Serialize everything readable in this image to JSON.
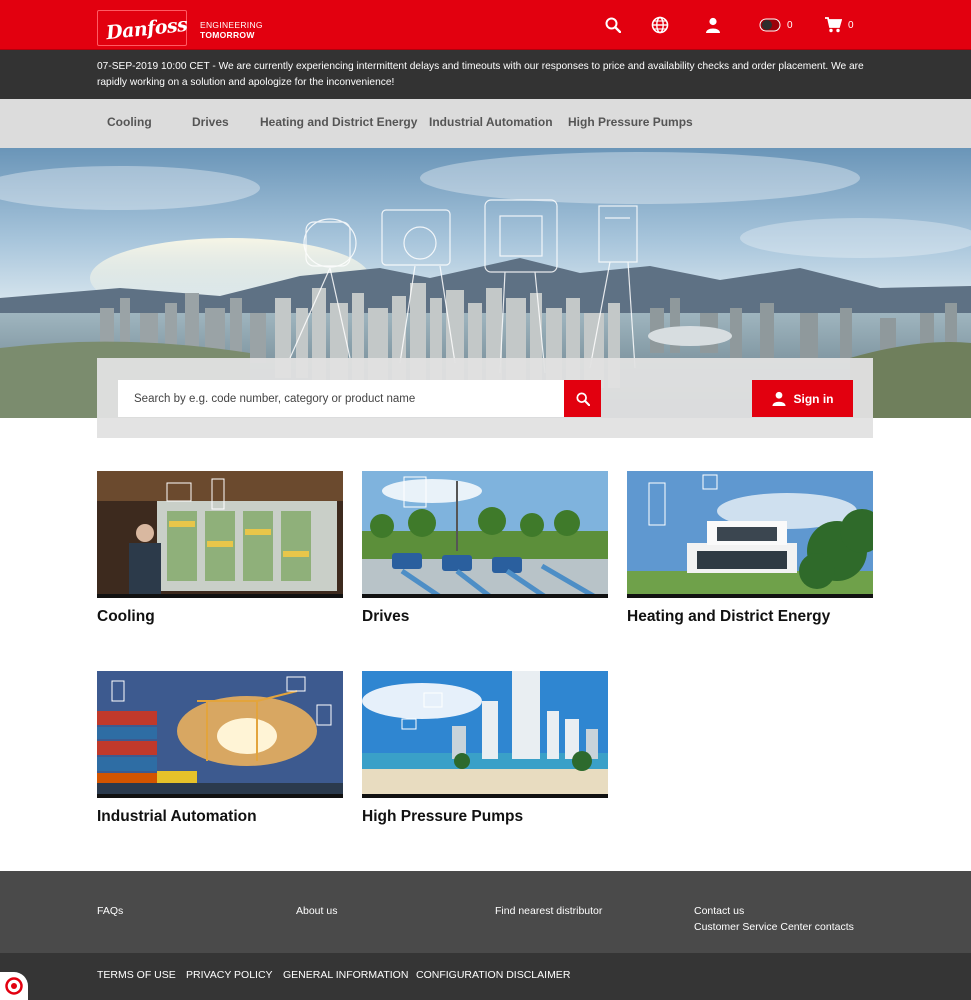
{
  "header": {
    "logo": "Danfoss",
    "tagline_line1": "ENGINEERING",
    "tagline_line2": "TOMORROW",
    "icons": [
      "search-icon",
      "globe-icon",
      "user-icon",
      "compare-toggle-icon",
      "cart-icon"
    ],
    "compare_count": "0",
    "cart_count": "0"
  },
  "notice": {
    "text": "07-SEP-2019 10:00 CET - We are currently experiencing intermittent delays and timeouts with our responses to price and availability checks and order placement. We are rapidly working on a solution and apologize for the inconvenience!"
  },
  "nav": {
    "items": [
      "Cooling",
      "Drives",
      "Heating and District Energy",
      "Industrial Automation",
      "High Pressure Pumps"
    ]
  },
  "search": {
    "placeholder": "Search by e.g. code number, category or product name",
    "signin_label": "Sign in"
  },
  "categories": [
    {
      "title": "Cooling"
    },
    {
      "title": "Drives"
    },
    {
      "title": "Heating and District Energy"
    },
    {
      "title": "Industrial Automation"
    },
    {
      "title": "High Pressure Pumps"
    }
  ],
  "footer": {
    "faqs": "FAQs",
    "about": "About us",
    "distributor": "Find nearest distributor",
    "contact": "Contact us",
    "service": "Customer Service Center contacts",
    "bottom_links": [
      "TERMS OF USE",
      "PRIVACY POLICY",
      "GENERAL INFORMATION",
      "CONFIGURATION DISCLAIMER"
    ]
  },
  "colors": {
    "brand_red": "#e2000f",
    "notice_bg": "#333333",
    "nav_bg": "#dcdcdc",
    "footer_bg": "#4a4a4a",
    "footer_bottom_bg": "#353535"
  }
}
